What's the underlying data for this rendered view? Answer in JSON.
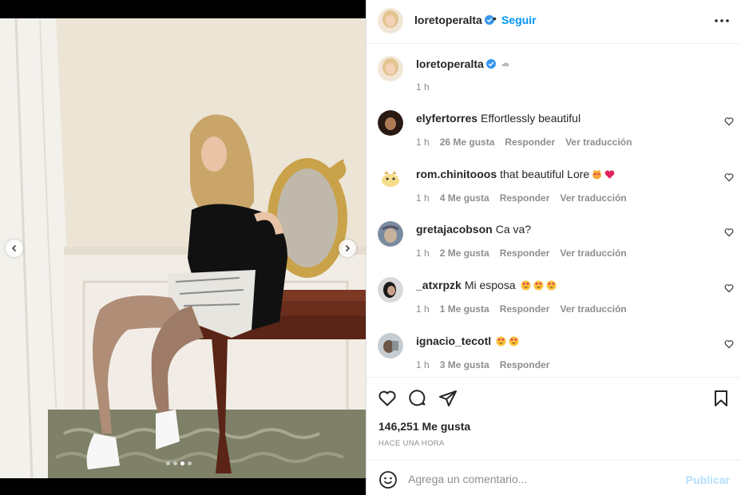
{
  "post": {
    "username": "loretoperalta",
    "follow_label": "Seguir",
    "separator": "•",
    "caption_time": "1 h",
    "photo_description_icon": "photo-of-woman-sitting-on-table",
    "carousel": {
      "total": 4,
      "current": 3
    }
  },
  "comments": [
    {
      "user": "elyfertorres",
      "text": "Effortlessly beautiful",
      "time": "1 h",
      "likes": "26 Me gusta",
      "reply": "Responder",
      "translate": "Ver traducción",
      "emojis": []
    },
    {
      "user": "rom.chinitooos",
      "text": "that beautiful Lore",
      "time": "1 h",
      "likes": "4 Me gusta",
      "reply": "Responder",
      "translate": "Ver traducción",
      "emojis": [
        "cat-heart-eyes-emoji",
        "red-heart-emoji"
      ]
    },
    {
      "user": "gretajacobson",
      "text": "Ca va?",
      "time": "1 h",
      "likes": "2 Me gusta",
      "reply": "Responder",
      "translate": "Ver traducción",
      "emojis": []
    },
    {
      "user": "_atxrpzk",
      "text": "Mi esposa",
      "time": "1 h",
      "likes": "1 Me gusta",
      "reply": "Responder",
      "translate": "Ver traducción",
      "emojis": [
        "heart-eyes-emoji",
        "heart-eyes-emoji",
        "heart-eyes-emoji"
      ]
    },
    {
      "user": "ignacio_tecotl",
      "text": "",
      "time": "1 h",
      "likes": "3 Me gusta",
      "reply": "Responder",
      "translate": "",
      "emojis": [
        "heart-eyes-emoji",
        "heart-eyes-emoji"
      ]
    }
  ],
  "actions": {
    "likes": "146,251 Me gusta",
    "time_ago": "HACE UNA HORA"
  },
  "add_comment": {
    "placeholder": "Agrega un comentario...",
    "post_label": "Publicar"
  },
  "colors": {
    "accent": "#0095f6",
    "verified": "#3897f0",
    "muted": "#8e8e8e",
    "post_disabled": "#b2dffc"
  }
}
